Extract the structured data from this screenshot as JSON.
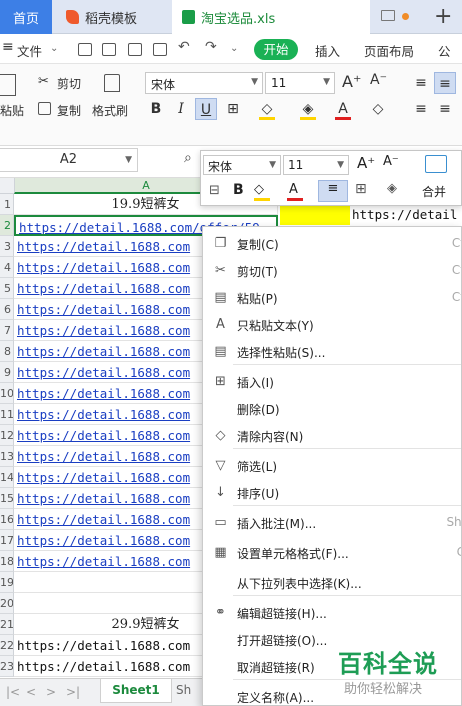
{
  "tabs": {
    "home": "首页",
    "templates": "稻壳模板",
    "file": "淘宝选品.xls"
  },
  "menu": {
    "file": "文件",
    "start": "开始",
    "insert": "插入",
    "page_layout": "页面布局",
    "formulas": "公式"
  },
  "ribbon": {
    "cut": "剪切",
    "copy": "复制",
    "paste": "粘贴",
    "format_painter": "格式刷",
    "font_name": "宋体",
    "font_size": "11"
  },
  "formula_bar": {
    "cell_ref": "A2"
  },
  "grid": {
    "column_a": "A",
    "rows": [
      {
        "num": "1",
        "text": "19.9短裤女",
        "kind": "head"
      },
      {
        "num": "2",
        "text": "https://detail.1688.com/offer/59",
        "kind": "link"
      },
      {
        "num": "3",
        "text": "https://detail.1688.com",
        "kind": "link"
      },
      {
        "num": "4",
        "text": "https://detail.1688.com",
        "kind": "link"
      },
      {
        "num": "5",
        "text": "https://detail.1688.com",
        "kind": "link"
      },
      {
        "num": "6",
        "text": "https://detail.1688.com",
        "kind": "link"
      },
      {
        "num": "7",
        "text": "https://detail.1688.com",
        "kind": "link"
      },
      {
        "num": "8",
        "text": "https://detail.1688.com",
        "kind": "link"
      },
      {
        "num": "9",
        "text": "https://detail.1688.com",
        "kind": "link"
      },
      {
        "num": "10",
        "text": "https://detail.1688.com",
        "kind": "link"
      },
      {
        "num": "11",
        "text": "https://detail.1688.com",
        "kind": "link"
      },
      {
        "num": "12",
        "text": "https://detail.1688.com",
        "kind": "link"
      },
      {
        "num": "13",
        "text": "https://detail.1688.com",
        "kind": "link"
      },
      {
        "num": "14",
        "text": "https://detail.1688.com",
        "kind": "link"
      },
      {
        "num": "15",
        "text": "https://detail.1688.com",
        "kind": "link"
      },
      {
        "num": "16",
        "text": "https://detail.1688.com",
        "kind": "link"
      },
      {
        "num": "17",
        "text": "https://detail.1688.com",
        "kind": "link"
      },
      {
        "num": "18",
        "text": "https://detail.1688.com",
        "kind": "link"
      },
      {
        "num": "19",
        "text": "",
        "kind": "empty"
      },
      {
        "num": "20",
        "text": "",
        "kind": "empty"
      },
      {
        "num": "21",
        "text": "29.9短裤女",
        "kind": "head"
      },
      {
        "num": "22",
        "text": "https://detail.1688.com",
        "kind": "plain"
      },
      {
        "num": "23",
        "text": "https://detail.1688.com",
        "kind": "plain"
      }
    ],
    "c2_text": "https://detail"
  },
  "mini_toolbar": {
    "font_name": "宋体",
    "font_size": "11",
    "merge": "合并"
  },
  "context_menu": {
    "items": [
      {
        "label": "复制(C)",
        "shortcut": "Ct",
        "icon": "copy-icon"
      },
      {
        "label": "剪切(T)",
        "shortcut": "Ct",
        "icon": "scissors-icon"
      },
      {
        "label": "粘贴(P)",
        "shortcut": "Ct",
        "icon": "paste-icon"
      },
      {
        "label": "只粘贴文本(Y)",
        "shortcut": "",
        "icon": "paste-text-icon"
      },
      {
        "label": "选择性粘贴(S)...",
        "shortcut": "",
        "icon": "paste-special-icon"
      },
      {
        "label": "插入(I)",
        "shortcut": "",
        "icon": "insert-icon"
      },
      {
        "label": "删除(D)",
        "shortcut": "",
        "icon": ""
      },
      {
        "label": "清除内容(N)",
        "shortcut": "",
        "icon": "eraser-icon"
      },
      {
        "label": "筛选(L)",
        "shortcut": "",
        "icon": "filter-icon"
      },
      {
        "label": "排序(U)",
        "shortcut": "",
        "icon": "sort-icon"
      },
      {
        "label": "插入批注(M)...",
        "shortcut": "Shi",
        "icon": "comment-icon"
      },
      {
        "label": "设置单元格格式(F)...",
        "shortcut": "C",
        "icon": "format-cells-icon"
      },
      {
        "label": "从下拉列表中选择(K)...",
        "shortcut": "",
        "icon": ""
      },
      {
        "label": "编辑超链接(H)...",
        "shortcut": "",
        "icon": "link-icon"
      },
      {
        "label": "打开超链接(O)...",
        "shortcut": "",
        "icon": ""
      },
      {
        "label": "取消超链接(R)",
        "shortcut": "",
        "icon": ""
      },
      {
        "label": "定义名称(A)...",
        "shortcut": "",
        "icon": ""
      }
    ]
  },
  "sheets": {
    "active": "Sheet1",
    "next": "Sh"
  },
  "watermark": {
    "title": "百科全说",
    "subtitle": "助你轻松解决"
  },
  "colors": {
    "accent_green": "#1ab155",
    "home_tab": "#3d7fe6",
    "link_blue": "#1a3ec2",
    "highlight_yellow": "#ffff00"
  }
}
